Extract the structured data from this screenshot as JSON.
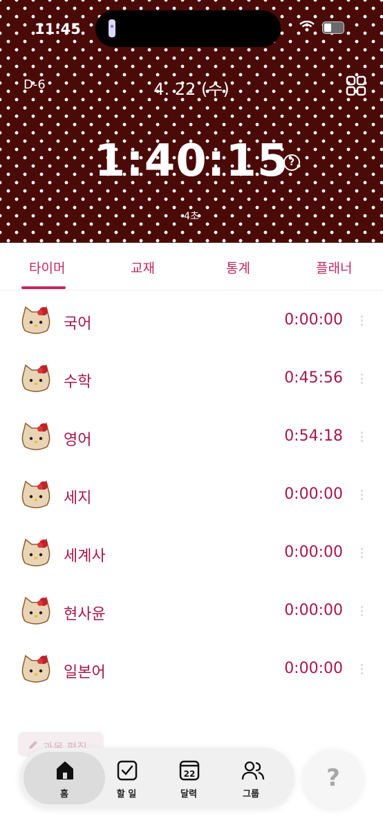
{
  "status": {
    "time": "11:45"
  },
  "header": {
    "dday": "D-6",
    "date": "4. 22 (수)",
    "timer": "1:40:15",
    "seconds": "4초",
    "help_glyph": "?"
  },
  "tabs": [
    {
      "label": "타이머",
      "active": true
    },
    {
      "label": "교재",
      "active": false
    },
    {
      "label": "통계",
      "active": false
    },
    {
      "label": "플래너",
      "active": false
    }
  ],
  "subjects": [
    {
      "name": "국어",
      "time": "0:00:00"
    },
    {
      "name": "수학",
      "time": "0:45:56"
    },
    {
      "name": "영어",
      "time": "0:54:18"
    },
    {
      "name": "세지",
      "time": "0:00:00"
    },
    {
      "name": "세계사",
      "time": "0:00:00"
    },
    {
      "name": "현사윤",
      "time": "0:00:00"
    },
    {
      "name": "일본어",
      "time": "0:00:00"
    }
  ],
  "edit_button": {
    "label": "과목 편집"
  },
  "nav": [
    {
      "label": "홈",
      "icon": "home-icon",
      "active": true
    },
    {
      "label": "할 일",
      "icon": "checkbox-icon",
      "active": false
    },
    {
      "label": "달력",
      "icon": "calendar-icon",
      "badge": "22",
      "active": false
    },
    {
      "label": "그룹",
      "icon": "group-icon",
      "active": false
    }
  ],
  "help_button": {
    "glyph": "?"
  },
  "colors": {
    "header_bg": "#4a0a08",
    "accent": "#c4275c",
    "subject_text": "#a8174a"
  }
}
